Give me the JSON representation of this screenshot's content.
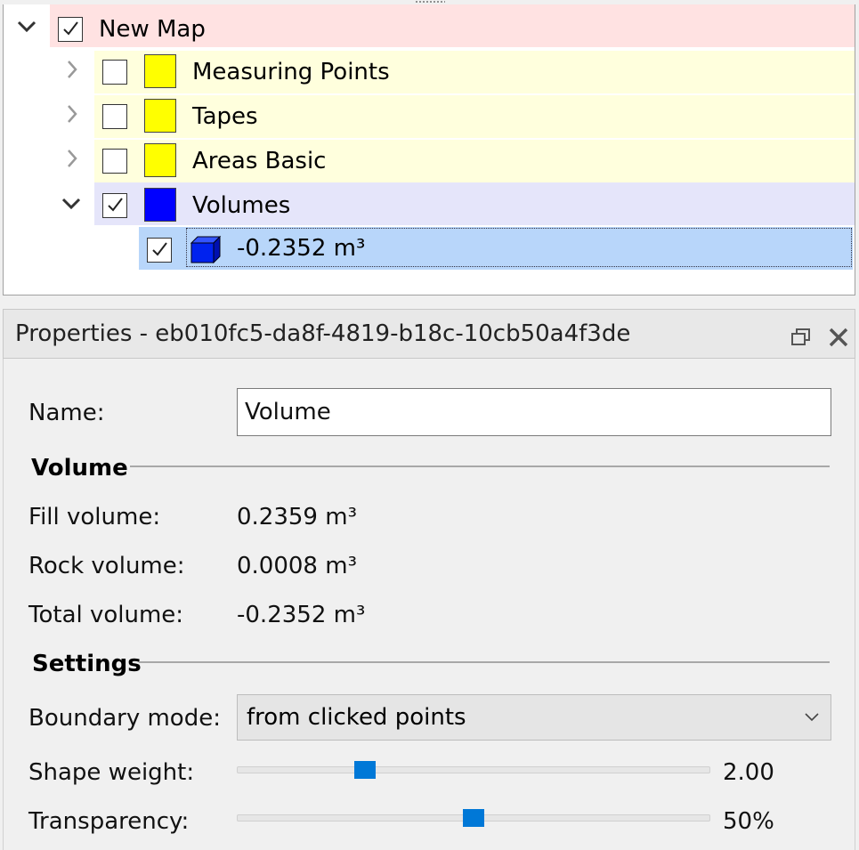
{
  "tree": {
    "root": {
      "label": "New Map",
      "checked": true,
      "expanded": true
    },
    "layers": [
      {
        "label": "Measuring Points",
        "checked": false,
        "expanded": false,
        "color": "#ffff00"
      },
      {
        "label": "Tapes",
        "checked": false,
        "expanded": false,
        "color": "#ffff00"
      },
      {
        "label": "Areas Basic",
        "checked": false,
        "expanded": false,
        "color": "#ffff00"
      },
      {
        "label": "Volumes",
        "checked": true,
        "expanded": true,
        "color": "#0000ff"
      }
    ],
    "child": {
      "label": "-0.2352 m³",
      "checked": true,
      "selected": true,
      "color": "#0000ff"
    }
  },
  "properties": {
    "title": "Properties - eb010fc5-da8f-4819-b18c-10cb50a4f3de",
    "name_label": "Name:",
    "name_value": "Volume",
    "volume_section": "Volume",
    "fill_label": "Fill volume:",
    "fill_value": "0.2359 m³",
    "rock_label": "Rock volume:",
    "rock_value": "0.0008 m³",
    "total_label": "Total volume:",
    "total_value": "-0.2352 m³",
    "settings_section": "Settings",
    "boundary_label": "Boundary mode:",
    "boundary_value": "from clicked points",
    "shape_label": "Shape weight:",
    "shape_value": "2.00",
    "shape_slider_fraction": 0.26,
    "transparency_label": "Transparency:",
    "transparency_value": "50%",
    "transparency_slider_fraction": 0.5
  },
  "icons": {
    "restore": "restore-window-icon",
    "close": "close-icon",
    "volume": "volume-cube-icon"
  },
  "colors": {
    "accent": "#0078d7",
    "root_highlight": "#ffe2e2",
    "layer_highlight": "#ffffdd",
    "volumes_highlight": "#e5e5fa",
    "selection": "#b8d6fa"
  }
}
